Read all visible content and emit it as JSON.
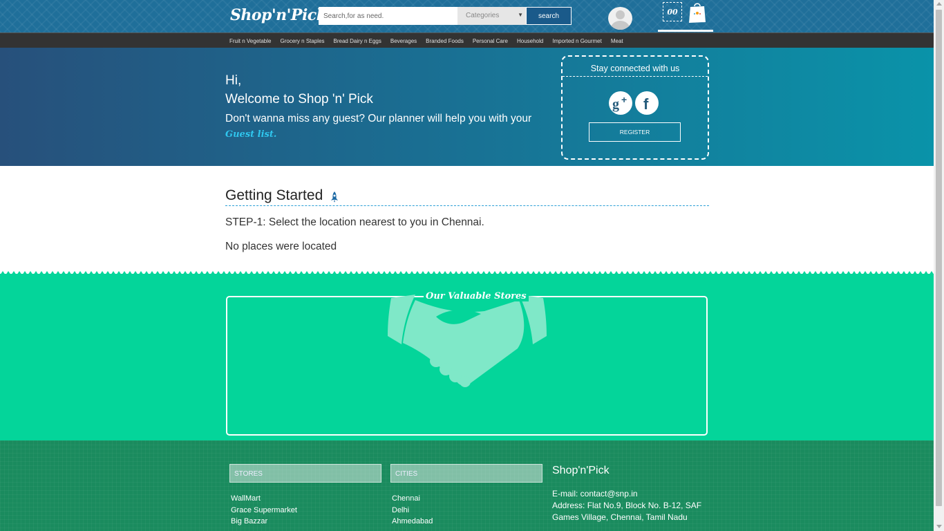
{
  "header": {
    "logo": "Shop'n'Pick",
    "search_placeholder": "Search,for as need.",
    "category_value": "Categories",
    "search_button": "search",
    "cart_count": "00"
  },
  "nav": {
    "categories": [
      "Fruit n Vegetable",
      "Grocery n Staples",
      "Bread Dairy n Eggs",
      "Beverages",
      "Branded Foods",
      "Personal Care",
      "Household",
      "Imported n Gourmet",
      "Meat"
    ]
  },
  "hero": {
    "hi": "Hi,",
    "welcome": "Welcome to Shop 'n' Pick",
    "subtitle": "Don't wanna miss any guest? Our planner will help you with your",
    "guest_link": "Guest list.",
    "connect_title": "Stay connected with us",
    "register_button": "REGISTER"
  },
  "getting_started": {
    "title": "Getting Started",
    "step1": "STEP-1: Select the location nearest to you in Chennai.",
    "empty_message": "No places were located"
  },
  "stores_section": {
    "title": "Our Valuable Stores"
  },
  "footer": {
    "stores_heading": "STORES",
    "stores": [
      "WallMart",
      "Grace Supermarket",
      "Big Bazzar"
    ],
    "cities_heading": "CITIES",
    "cities": [
      "Chennai",
      "Delhi",
      "Ahmedabad"
    ],
    "brand": "Shop'n'Pick",
    "email": "E-mail: contact@snp.in",
    "address": "Address: Flat No.9, Block No. B-12, SAF Games Village, Chennai, Tamil Nadu"
  },
  "colors": {
    "header_bg": "#1f6f9a",
    "nav_bg": "#333333",
    "stores_bg": "#04d59a",
    "footer_bg": "#1a8b5e",
    "link_accent": "#2fc6ee"
  },
  "icons": {
    "user": "avatar-icon",
    "cart": "shopping-bag-icon",
    "rocket": "rocket-icon",
    "gplus": "google-plus-icon",
    "facebook": "facebook-icon",
    "handshake": "handshake-icon"
  }
}
